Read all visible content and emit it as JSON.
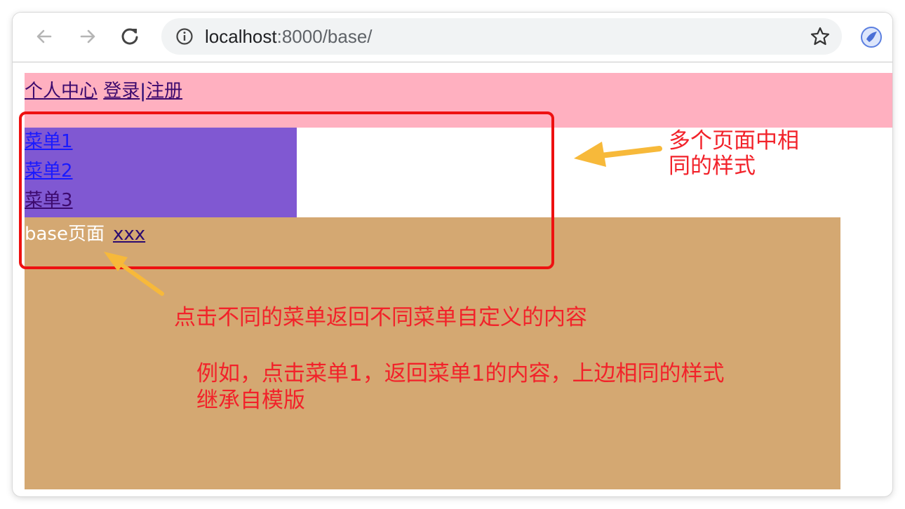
{
  "browser": {
    "url_host": "localhost",
    "url_rest": ":8000/base/",
    "icons": [
      "back-arrow-icon",
      "forward-arrow-icon",
      "reload-icon",
      "info-icon",
      "star-icon",
      "extension-icon"
    ]
  },
  "page": {
    "header": {
      "link_profile": "个人中心",
      "link_login": "登录",
      "separator": "|",
      "link_register": "注册"
    },
    "menu": [
      {
        "label": "菜单1",
        "color": "#1a1aff"
      },
      {
        "label": "菜单2",
        "color": "#1a1aff"
      },
      {
        "label": "菜单3",
        "color": "#3d0a6e"
      }
    ],
    "main": {
      "title": "base页面",
      "link": "xxx"
    }
  },
  "annotations": {
    "shared_style_line1": "多个页面中相",
    "shared_style_line2": "同的样式",
    "click_note": "点击不同的菜单返回不同菜单自定义的内容",
    "example_line1": "例如，点击菜单1，返回菜单1的内容，上边相同的样式",
    "example_line2": "继承自模版"
  },
  "colors": {
    "header_bg": "#ffb0c0",
    "sidebar_bg": "#8058d2",
    "main_bg": "#d4a872",
    "annotation_red": "#f2222a",
    "arrow_yellow": "#f7b93a"
  }
}
